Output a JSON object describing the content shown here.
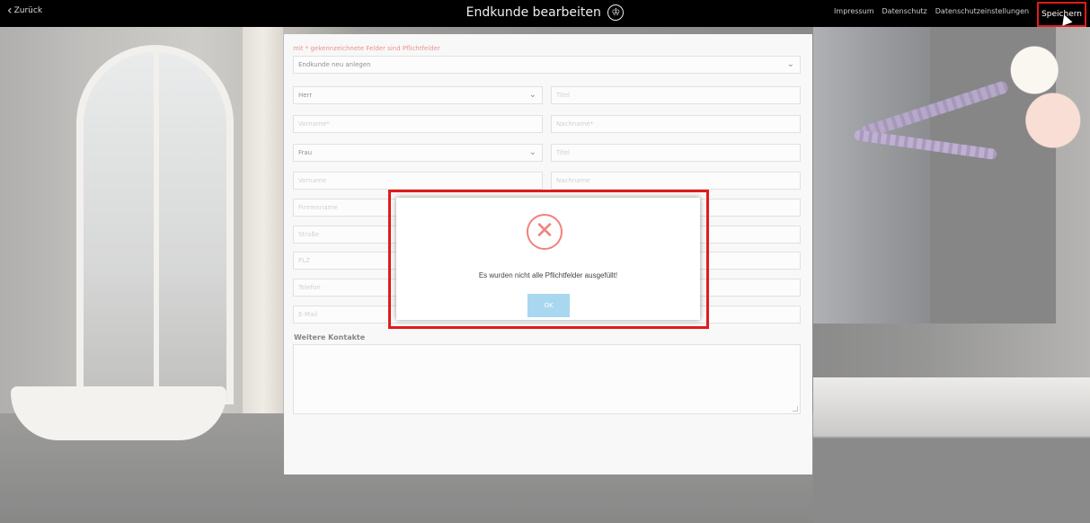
{
  "header": {
    "back_label": "Zurück",
    "title": "Endkunde bearbeiten",
    "nav": [
      "Impressum",
      "Datenschutz",
      "Datenschutzeinstellungen"
    ],
    "save_label": "Speichern"
  },
  "form": {
    "required_note": "mit * gekennzeichnete Felder sind Pflichtfelder",
    "customer_select": "Endkunde neu anlegen",
    "salutation1": "Herr",
    "title1": "Titel",
    "firstname1": "Vorname*",
    "lastname1": "Nachname*",
    "salutation2": "Frau",
    "title2": "Titel",
    "firstname2": "Vorname",
    "lastname2": "Nachname",
    "company": "Firmenname",
    "street": "Straße",
    "zip": "PLZ",
    "phone": "Telefon",
    "email": "E-Mail",
    "further_contacts_label": "Weitere Kontakte"
  },
  "dialog": {
    "message": "Es wurden nicht alle Pflichtfelder ausgefüllt!",
    "ok_label": "OK",
    "icon": "error-x-icon"
  },
  "colors": {
    "highlight": "#e21b1b",
    "error_icon": "#f0827a",
    "ok_button": "#a8d7ef"
  }
}
